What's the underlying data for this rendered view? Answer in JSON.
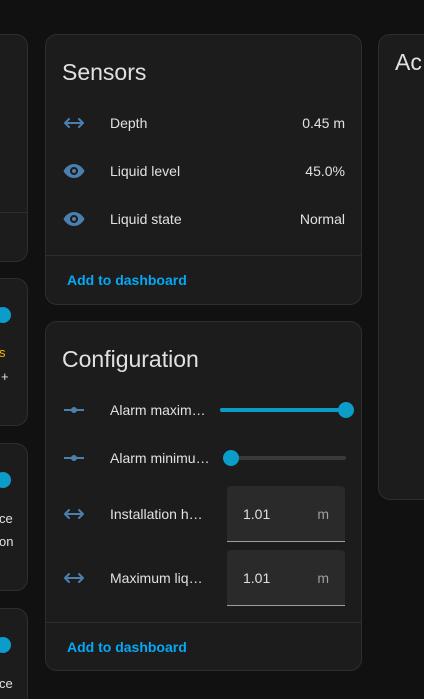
{
  "left_column": {
    "frag_text_1": "s",
    "frag_text_2": "+",
    "frag_text_3": "ce",
    "frag_text_4": "on",
    "frag_text_5": "ce"
  },
  "sensors": {
    "title": "Sensors",
    "rows": [
      {
        "icon": "arrow-left-right-icon",
        "label": "Depth",
        "value": "0.45 m"
      },
      {
        "icon": "eye-icon",
        "label": "Liquid level",
        "value": "45.0%"
      },
      {
        "icon": "eye-icon",
        "label": "Liquid state",
        "value": "Normal"
      }
    ],
    "action": "Add to dashboard"
  },
  "configuration": {
    "title": "Configuration",
    "sliders": [
      {
        "icon": "ray-vertex-icon",
        "label": "Alarm maxim…",
        "fraction": 1.0
      },
      {
        "icon": "ray-vertex-icon",
        "label": "Alarm minimu…",
        "fraction": 0.0
      }
    ],
    "numbers": [
      {
        "icon": "arrow-left-right-icon",
        "label": "Installation h…",
        "value": "1.01",
        "unit": "m"
      },
      {
        "icon": "arrow-left-right-icon",
        "label": "Maximum liq…",
        "value": "1.01",
        "unit": "m"
      }
    ],
    "action": "Add to dashboard"
  },
  "right_card": {
    "title_fragment": "Ac"
  },
  "colors": {
    "accent": "#03a9f4",
    "slider": "#0b9cc9",
    "icon": "#4a7fae",
    "warning": "#ffb300"
  }
}
